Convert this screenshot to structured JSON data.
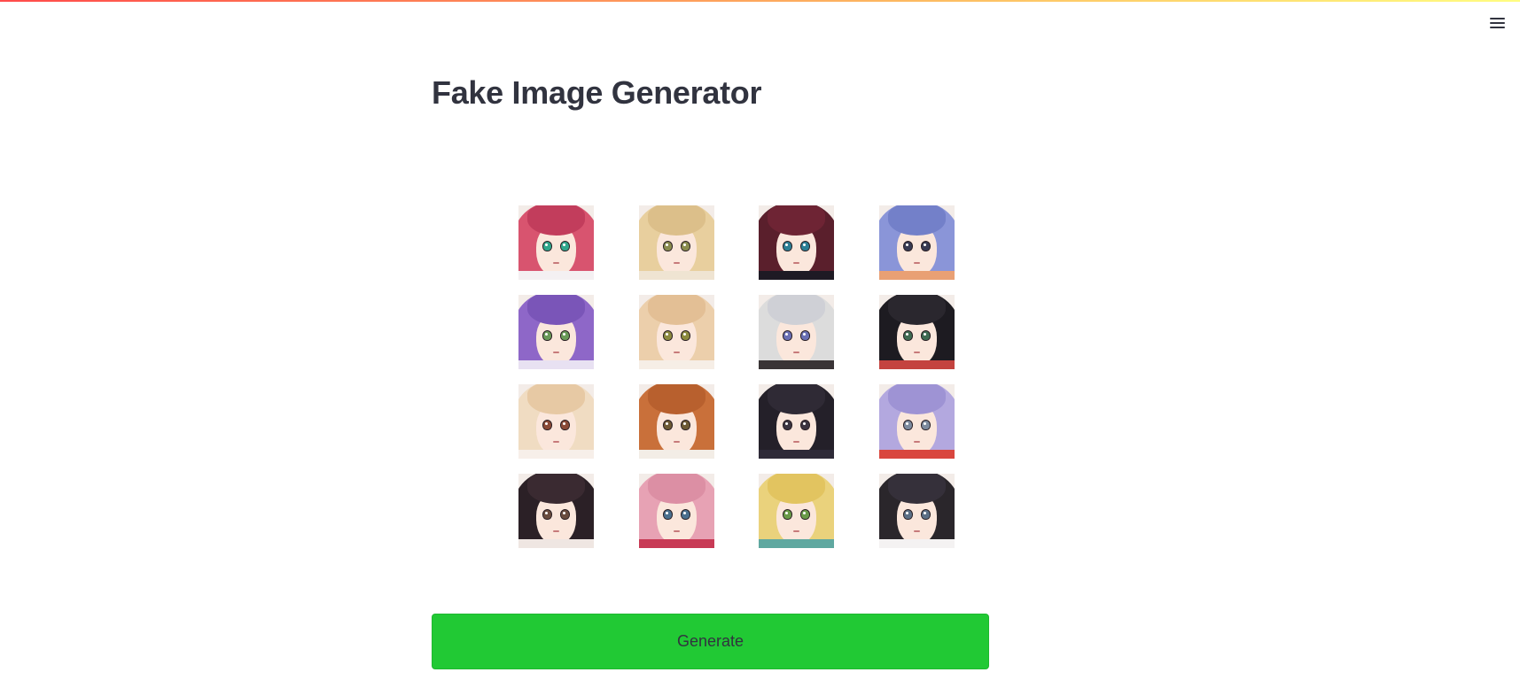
{
  "page": {
    "title": "Fake Image Generator"
  },
  "header": {
    "menu_icon": "hamburger-menu-icon",
    "decoration_colors": [
      "#ff4b4b",
      "#fdba61",
      "#fffd80"
    ]
  },
  "generator": {
    "button_label": "Generate",
    "button_color": "#21c934",
    "images": [
      {
        "hair": "#d8546f",
        "bangs": "#c23d5c",
        "eyes": "#2fa78c",
        "collar": "#f4f0f2"
      },
      {
        "hair": "#e8cf9e",
        "bangs": "#dcbf8a",
        "eyes": "#8a8c4e",
        "collar": "#efe4d2"
      },
      {
        "hair": "#5a1f2c",
        "bangs": "#6e2434",
        "eyes": "#2c7f95",
        "collar": "#1e1a24"
      },
      {
        "hair": "#8a95d8",
        "bangs": "#7380c9",
        "eyes": "#383a52",
        "collar": "#e9a074"
      },
      {
        "hair": "#8e67c8",
        "bangs": "#7a55b8",
        "eyes": "#6a9a58",
        "collar": "#e8e1f2"
      },
      {
        "hair": "#eccfab",
        "bangs": "#e3bf95",
        "eyes": "#8c8a3e",
        "collar": "#f6eee6"
      },
      {
        "hair": "#dcdcdc",
        "bangs": "#cfd0d6",
        "eyes": "#6a6fb4",
        "collar": "#3a3436"
      },
      {
        "hair": "#1d1b21",
        "bangs": "#2a272e",
        "eyes": "#3f6b52",
        "collar": "#c4433f"
      },
      {
        "hair": "#f0dcc2",
        "bangs": "#e7c9a4",
        "eyes": "#8a4a36",
        "collar": "#f7efe9"
      },
      {
        "hair": "#c9703a",
        "bangs": "#b8602e",
        "eyes": "#6d5a34",
        "collar": "#f3ede6"
      },
      {
        "hair": "#242029",
        "bangs": "#2f2a35",
        "eyes": "#3b3440",
        "collar": "#2e2a38"
      },
      {
        "hair": "#b3a8df",
        "bangs": "#9e93d4",
        "eyes": "#7c8a9e",
        "collar": "#d9463e"
      },
      {
        "hair": "#2b2026",
        "bangs": "#3a2a31",
        "eyes": "#6a4c3e",
        "collar": "#efe6e2"
      },
      {
        "hair": "#e7a2b4",
        "bangs": "#dc8fa4",
        "eyes": "#4a6f8e",
        "collar": "#c83a55"
      },
      {
        "hair": "#ead27c",
        "bangs": "#e2c460",
        "eyes": "#6a9a48",
        "collar": "#5fa8a0"
      },
      {
        "hair": "#2a262b",
        "bangs": "#35303a",
        "eyes": "#5b6f86",
        "collar": "#f4f2f2"
      }
    ]
  }
}
